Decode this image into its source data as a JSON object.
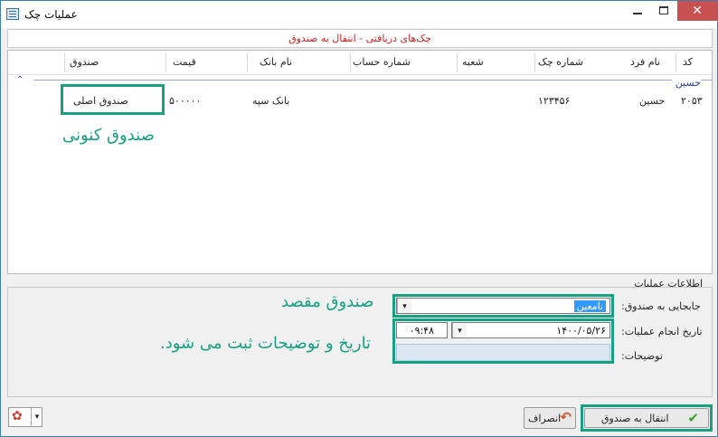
{
  "window": {
    "title": "عملیات چک",
    "minimize": "–",
    "maximize": "",
    "close": "✕"
  },
  "subtitle": "چک‌های دریافتی - انتقال به صندوق",
  "grid": {
    "columns": [
      "کد",
      "نام فرد",
      "شماره چک",
      "شعبه",
      "شماره حساب",
      "نام بانک",
      "قیمت",
      "صندوق"
    ],
    "group_label": "حسین",
    "collapse_glyph": "⌃",
    "row": {
      "code": "۲۰۵۳",
      "person": "حسین",
      "check_no": "۱۲۳۴۵۶",
      "branch": "",
      "account": "",
      "bank": "بانک سپه",
      "price": "۵۰۰۰۰۰",
      "fund": "صندوق اصلی"
    }
  },
  "annotations": {
    "current_fund": "صندوق کنونی",
    "target_fund": "صندوق مقصد",
    "date_note": "تاریخ و توضیحات ثبت می شود."
  },
  "operation_info": {
    "section_title": "اطلاعات عملیات",
    "transfer_label": "جابجایی به صندوق:",
    "transfer_value": "نامعین",
    "date_label": "تاریخ انجام عملیات:",
    "date_value": "۱۴۰۰/۰۵/۲۶",
    "time_value": "۰۹:۴۸",
    "desc_label": "توضیحات:",
    "dropdown_glyph": "▾"
  },
  "footer": {
    "transfer_button": "انتقال به صندوق",
    "cancel_button": "انصراف",
    "check_icon": "✔",
    "back_icon": "↶",
    "tool_glyph": "✿"
  },
  "colors": {
    "highlight": "#18a083",
    "title_red": "#d02020",
    "group_blue": "#2e3aa0"
  }
}
